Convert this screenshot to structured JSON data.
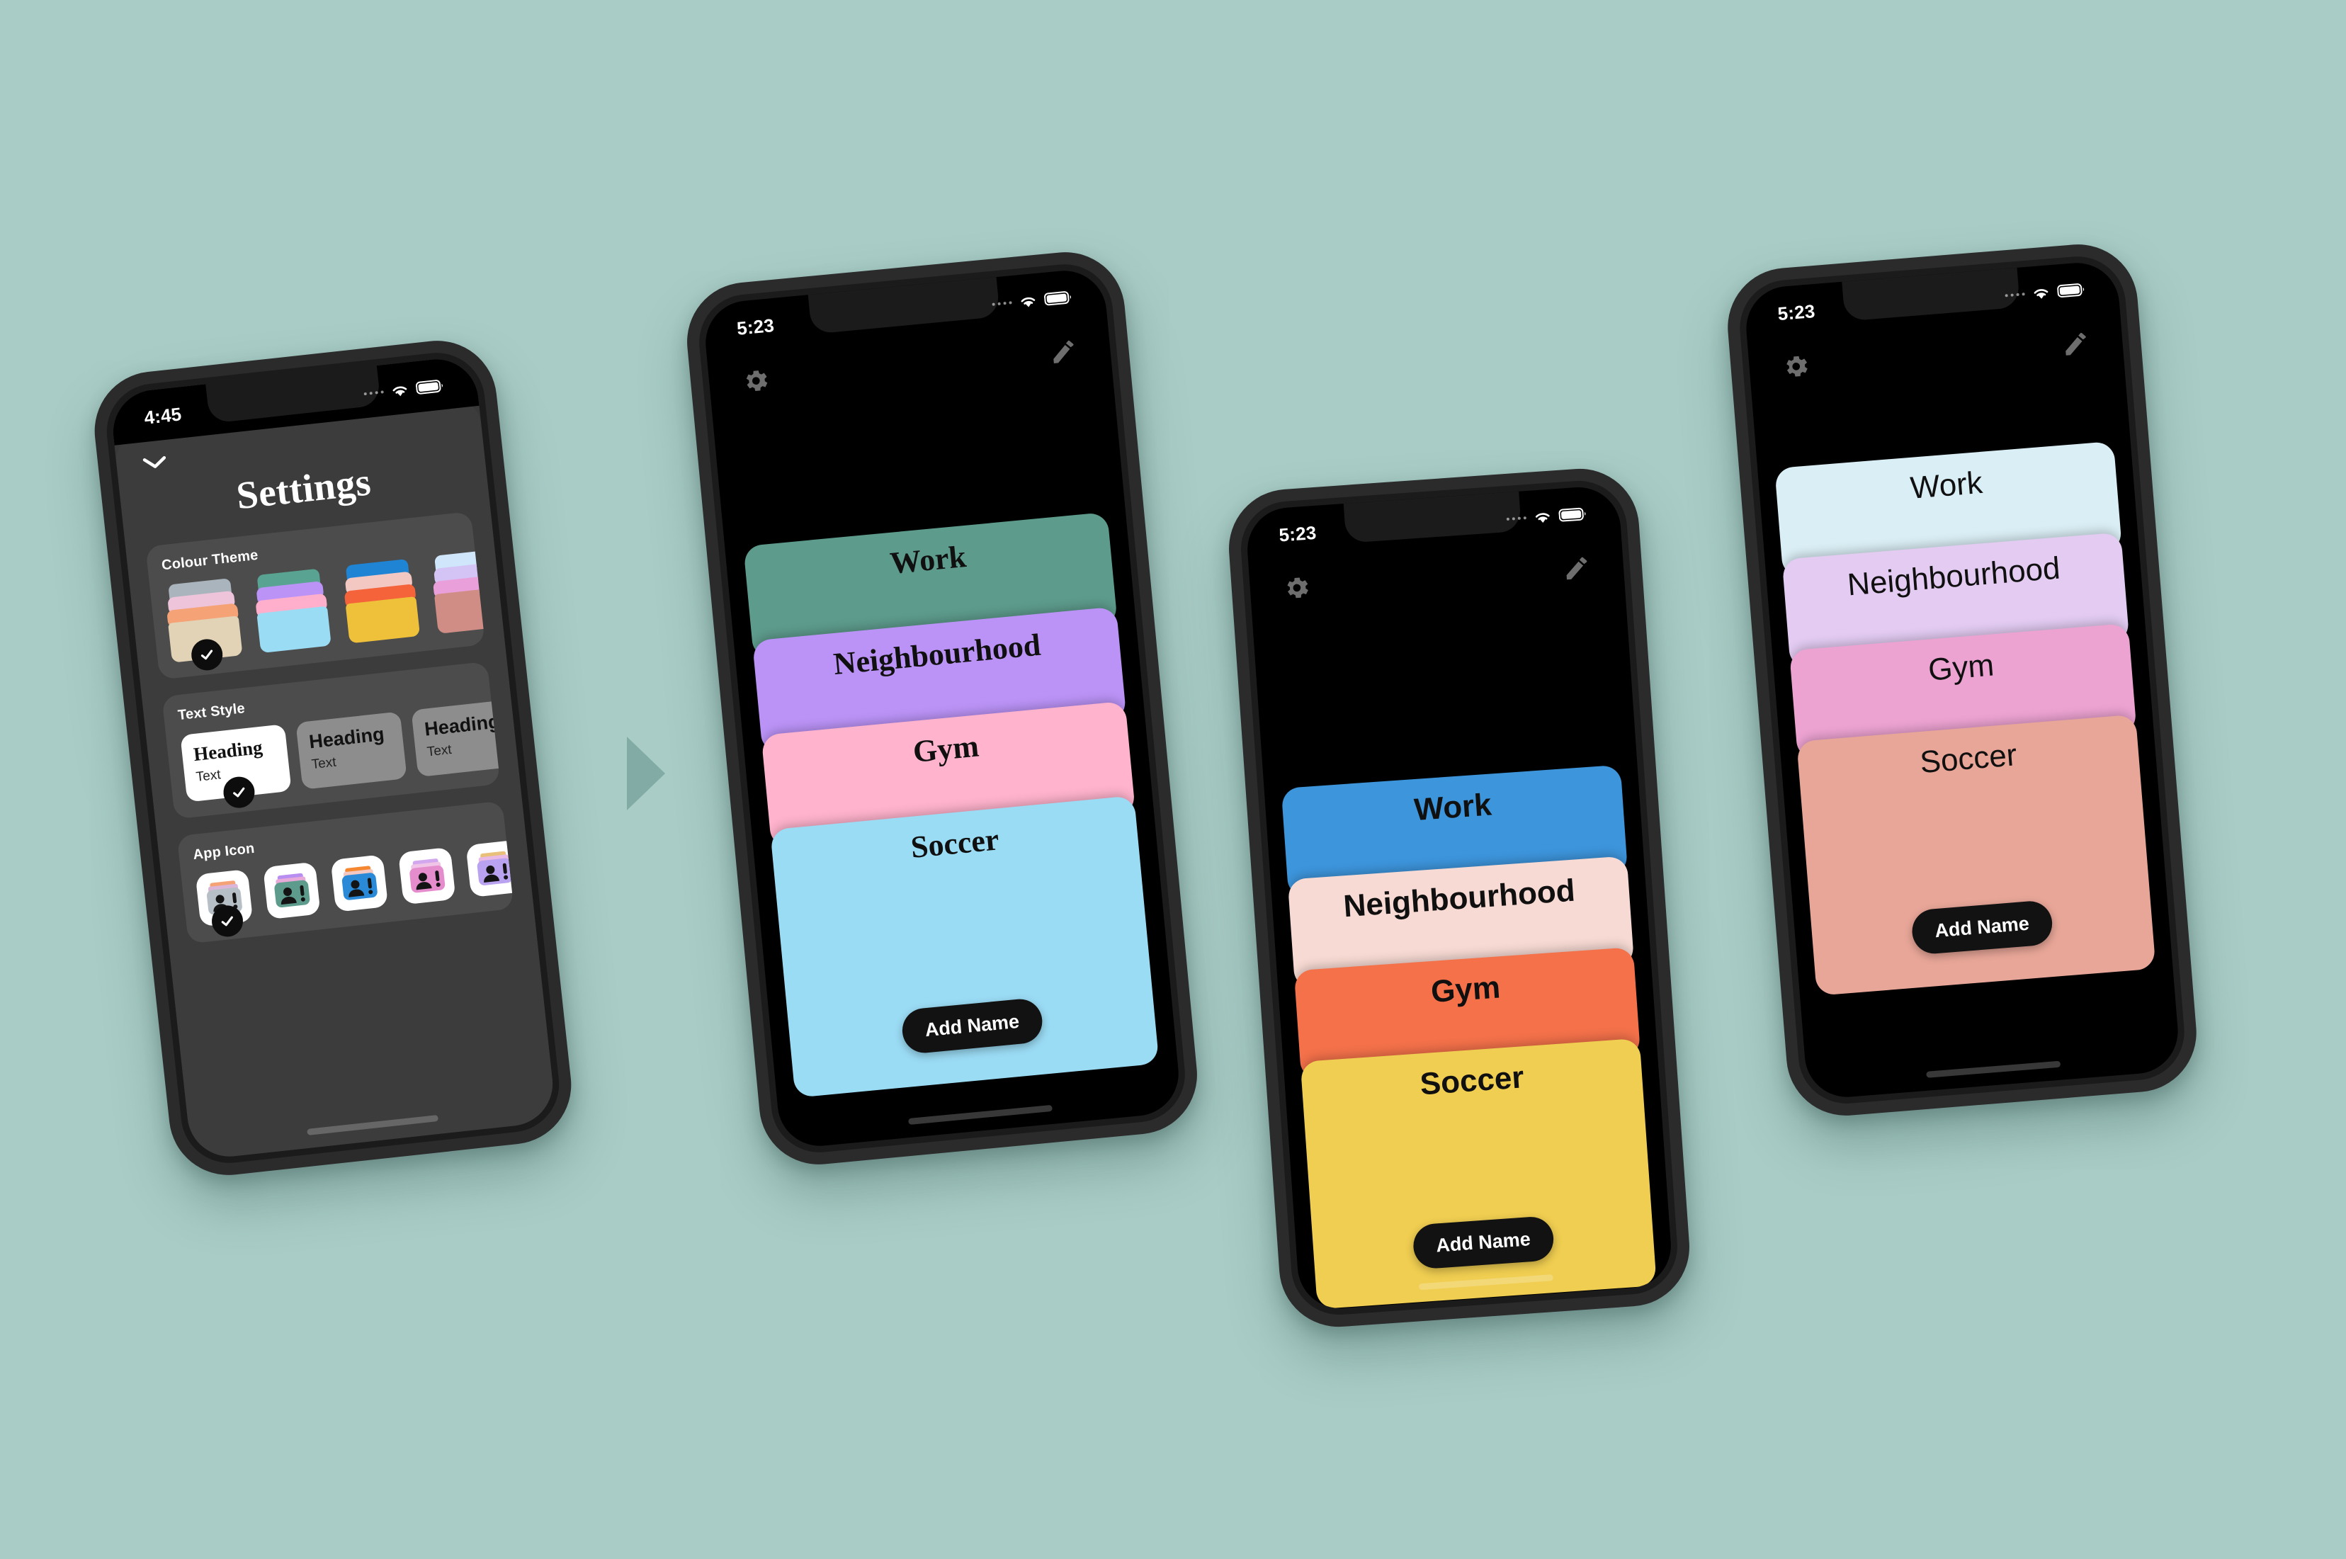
{
  "background_color": "#a9ccc6",
  "arrow": {
    "name": "flow-arrow",
    "color": "#82aba6"
  },
  "phone_settings": {
    "status": {
      "time": "4:45",
      "wifi_icon": "wifi-icon",
      "battery_icon": "battery-icon",
      "signal_icon": "signal-dots-icon"
    },
    "collapse_icon": "chevron-down-icon",
    "title": "Settings",
    "sections": {
      "colour_theme": {
        "label": "Colour Theme",
        "selected_index": 0,
        "check_icon": "check-icon",
        "themes": [
          {
            "name": "Greige",
            "layers": [
              "#aab4bc",
              "#edc4d9",
              "#f4a276",
              "#e3d3b6"
            ]
          },
          {
            "name": "Teal",
            "layers": [
              "#58a392",
              "#bb93f7",
              "#ffafcb",
              "#9bdcf5"
            ]
          },
          {
            "name": "Bold",
            "layers": [
              "#1f84d3",
              "#f3c7c2",
              "#f4633a",
              "#efc03a"
            ]
          },
          {
            "name": "Pastel",
            "layers": [
              "#cfe6fb",
              "#d4c3f5",
              "#e9a0da",
              "#d08d85"
            ]
          }
        ]
      },
      "text_style": {
        "label": "Text Style",
        "selected_index": 0,
        "check_icon": "check-icon",
        "styles": [
          {
            "heading": "Heading",
            "text": "Text",
            "font": "serif",
            "selected": true
          },
          {
            "heading": "Heading",
            "text": "Text",
            "font": "sans",
            "selected": false
          },
          {
            "heading": "Heading",
            "text": "Text",
            "font": "sans",
            "selected": false
          }
        ]
      },
      "app_icon": {
        "label": "App Icon",
        "selected_index": 0,
        "check_icon": "check-icon",
        "icons": [
          {
            "name": "app-icon-greige",
            "body": "#b6bfc6",
            "top1": "#f4a276",
            "top2": "#dcb6d8"
          },
          {
            "name": "app-icon-teal",
            "body": "#5d9b8c",
            "top1": "#b88ef0",
            "top2": "#e8aad8"
          },
          {
            "name": "app-icon-blue",
            "body": "#2a8ad8",
            "top1": "#f4872f",
            "top2": "#f3c7c2"
          },
          {
            "name": "app-icon-pink",
            "body": "#e58ccd",
            "top1": "#d2a7ee",
            "top2": "#f0c4e6"
          },
          {
            "name": "app-icon-lilac",
            "body": "#b9a2ef",
            "top1": "#e8c07a",
            "top2": "#e9b9e5"
          }
        ]
      }
    }
  },
  "phone_teal": {
    "status": {
      "time": "5:23",
      "wifi_icon": "wifi-icon",
      "battery_icon": "battery-icon",
      "signal_icon": "signal-dots-icon"
    },
    "gear_icon": "gear-icon",
    "pencil_icon": "pencil-icon",
    "font_style": "serif-bold",
    "add_name_label": "Add Name",
    "cards": [
      {
        "label": "Work",
        "color": "#5d9b8c"
      },
      {
        "label": "Neighbourhood",
        "color": "#bb93f7"
      },
      {
        "label": "Gym",
        "color": "#ffb3cc"
      },
      {
        "label": "Soccer",
        "color": "#9bdcf5"
      }
    ]
  },
  "phone_bold": {
    "status": {
      "time": "5:23",
      "wifi_icon": "wifi-icon",
      "battery_icon": "battery-icon",
      "signal_icon": "signal-dots-icon"
    },
    "gear_icon": "gear-icon",
    "pencil_icon": "pencil-icon",
    "font_style": "sans-bold",
    "add_name_label": "Add Name",
    "cards": [
      {
        "label": "Work",
        "color": "#3d95dc"
      },
      {
        "label": "Neighbourhood",
        "color": "#f7dad3"
      },
      {
        "label": "Gym",
        "color": "#f4714a"
      },
      {
        "label": "Soccer",
        "color": "#f0ce51"
      }
    ]
  },
  "phone_pastel": {
    "status": {
      "time": "5:23",
      "wifi_icon": "wifi-icon",
      "battery_icon": "battery-icon",
      "signal_icon": "signal-dots-icon"
    },
    "gear_icon": "gear-icon",
    "pencil_icon": "pencil-icon",
    "font_style": "sans-light",
    "add_name_label": "Add Name",
    "cards": [
      {
        "label": "Work",
        "color": "#daeef5"
      },
      {
        "label": "Neighbourhood",
        "color": "#e3cbf2"
      },
      {
        "label": "Gym",
        "color": "#eda3d2"
      },
      {
        "label": "Soccer",
        "color": "#e8a698"
      }
    ]
  }
}
